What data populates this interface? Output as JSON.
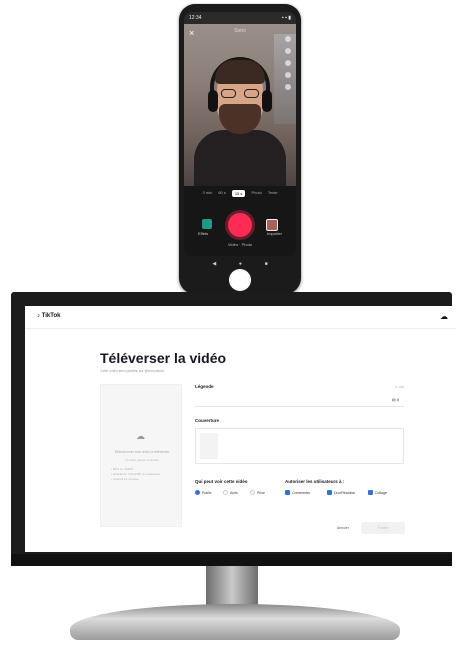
{
  "phone": {
    "status_time": "12:34",
    "status_icons": "▪ ▪ ▮",
    "title": "Sons",
    "modes": [
      "3 min",
      "60 s",
      "15 s",
      "Photo",
      "Texte"
    ],
    "selected_mode": "15 s",
    "effects_label": "Effets",
    "upload_label": "Importer",
    "sub_tabs": "Vidéo · Photo",
    "nav": [
      "◀",
      "●",
      "■"
    ]
  },
  "desktop": {
    "logo": "TikTok",
    "page_title": "Téléverser la vidéo",
    "page_subtitle": "Cette vidéo sera publiée sur @lemonlook",
    "dropzone": {
      "title": "Sélectionner une vidéo à téléverser",
      "subtitle": "Ou faire glisser un fichier",
      "requirements": [
        "MP4 ou WebM",
        "Résolution 720x1280 ou supérieure",
        "Jusqu'à 10 minutes"
      ]
    },
    "caption_label": "Légende",
    "caption_counter": "0 / 150",
    "caption_tools": "@ #",
    "cover_label": "Couverture",
    "visibility_label": "Qui peut voir cette vidéo",
    "visibility_options": [
      "Public",
      "Amis",
      "Privé"
    ],
    "allow_label": "Autoriser les utilisateurs à :",
    "allow_options": [
      "Commenter",
      "Duo/Réaction",
      "Collage"
    ],
    "discard_label": "Annuler",
    "post_label": "Publier"
  },
  "colors": {
    "accent": "#fe2c55",
    "checkbox": "#2f73e0"
  }
}
